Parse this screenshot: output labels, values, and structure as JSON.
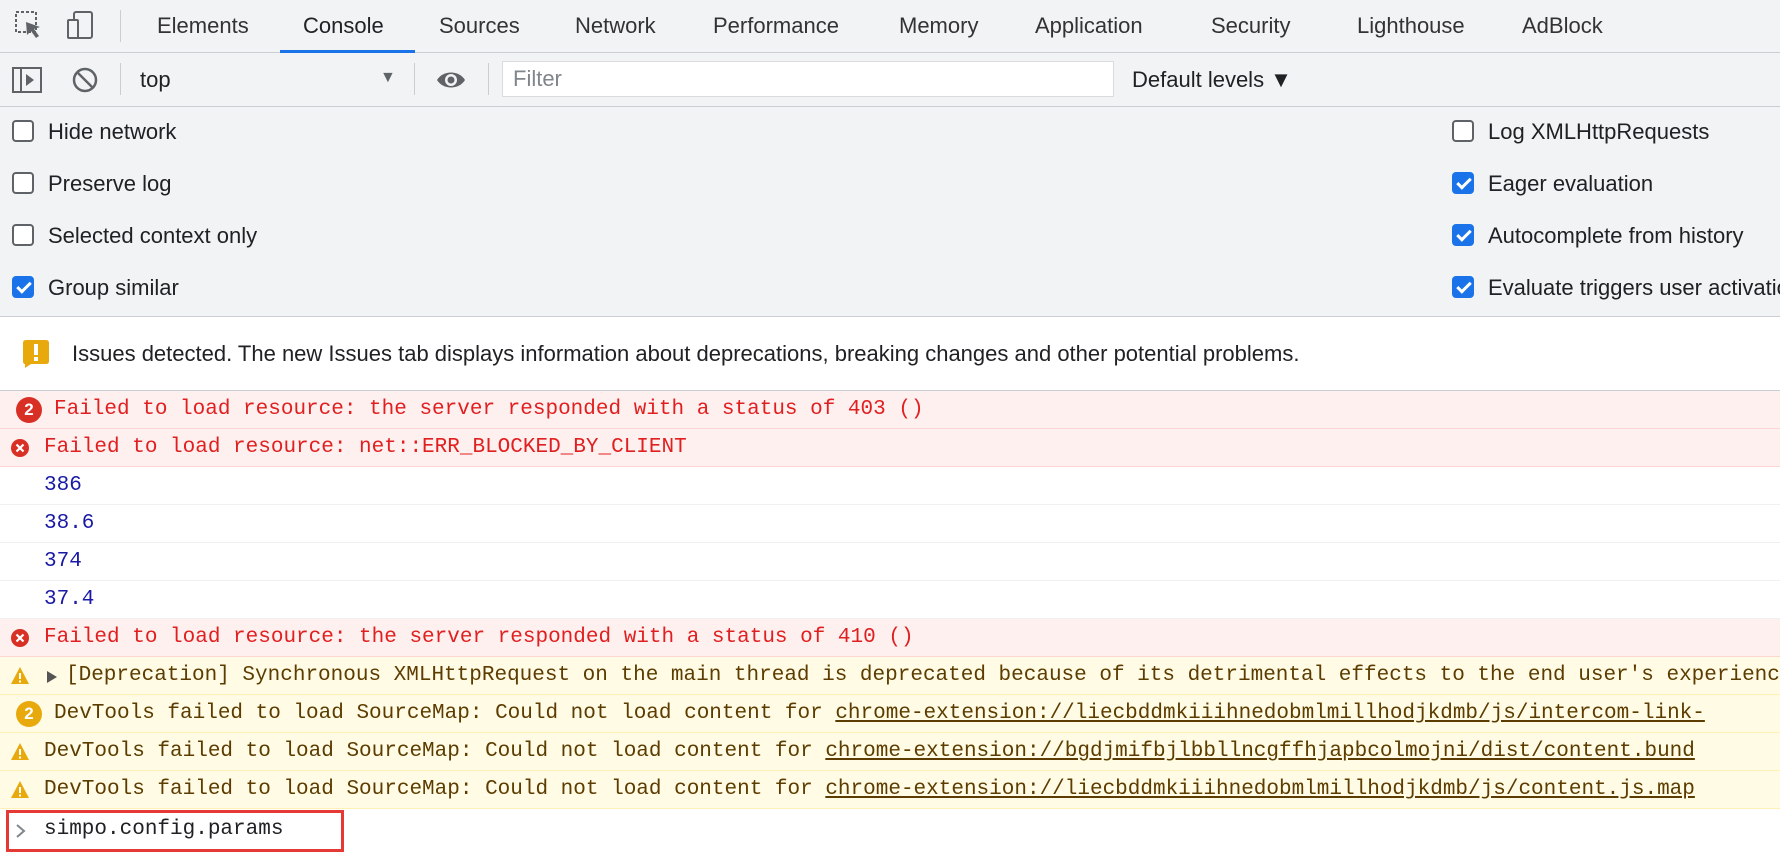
{
  "tabs": [
    {
      "label": "Elements",
      "active": false
    },
    {
      "label": "Console",
      "active": true
    },
    {
      "label": "Sources",
      "active": false
    },
    {
      "label": "Network",
      "active": false
    },
    {
      "label": "Performance",
      "active": false
    },
    {
      "label": "Memory",
      "active": false
    },
    {
      "label": "Application",
      "active": false
    },
    {
      "label": "Security",
      "active": false
    },
    {
      "label": "Lighthouse",
      "active": false
    },
    {
      "label": "AdBlock",
      "active": false
    }
  ],
  "toolbar": {
    "context": "top",
    "filter_placeholder": "Filter",
    "filter_value": "",
    "levels": "Default levels ▼"
  },
  "settings": {
    "left": [
      {
        "label": "Hide network",
        "checked": false
      },
      {
        "label": "Preserve log",
        "checked": false
      },
      {
        "label": "Selected context only",
        "checked": false
      },
      {
        "label": "Group similar",
        "checked": true
      }
    ],
    "right": [
      {
        "label": "Log XMLHttpRequests",
        "checked": false
      },
      {
        "label": "Eager evaluation",
        "checked": true
      },
      {
        "label": "Autocomplete from history",
        "checked": true
      },
      {
        "label": "Evaluate triggers user activation",
        "checked": true
      }
    ]
  },
  "issues_banner": "Issues detected. The new Issues tab displays information about deprecations, breaking changes and other potential problems.",
  "messages": [
    {
      "level": "error",
      "count": "2",
      "text": "Failed to load resource: the server responded with a status of 403 ()"
    },
    {
      "level": "error",
      "text": "Failed to load resource: net::ERR_BLOCKED_BY_CLIENT"
    },
    {
      "level": "log",
      "text": "386"
    },
    {
      "level": "log",
      "text": "38.6"
    },
    {
      "level": "log",
      "text": "374"
    },
    {
      "level": "log",
      "text": "37.4"
    },
    {
      "level": "error",
      "text": "Failed to load resource: the server responded with a status of 410 ()"
    },
    {
      "level": "warning",
      "expandable": true,
      "text": "[Deprecation] Synchronous XMLHttpRequest on the main thread is deprecated because of its detrimental effects to the end user's experience."
    },
    {
      "level": "warning",
      "count": "2",
      "text": "DevTools failed to load SourceMap: Could not load content for ",
      "link": "chrome-extension://liecbddmkiiihnedobmlmillhodjkdmb/js/intercom-link-"
    },
    {
      "level": "warning",
      "text": "DevTools failed to load SourceMap: Could not load content for ",
      "link": "chrome-extension://bgdjmifbjlbbllncgffhjapbcolmojni/dist/content.bund"
    },
    {
      "level": "warning",
      "text": "DevTools failed to load SourceMap: Could not load content for ",
      "link": "chrome-extension://liecbddmkiiihnedobmlmillhodjkdmb/js/content.js.map"
    }
  ],
  "prompt": {
    "input": "simpo.config.params"
  },
  "colors": {
    "accent": "#1a73e8",
    "error": "#e02020",
    "warning": "#e8a90c",
    "highlight": "#e53935"
  }
}
